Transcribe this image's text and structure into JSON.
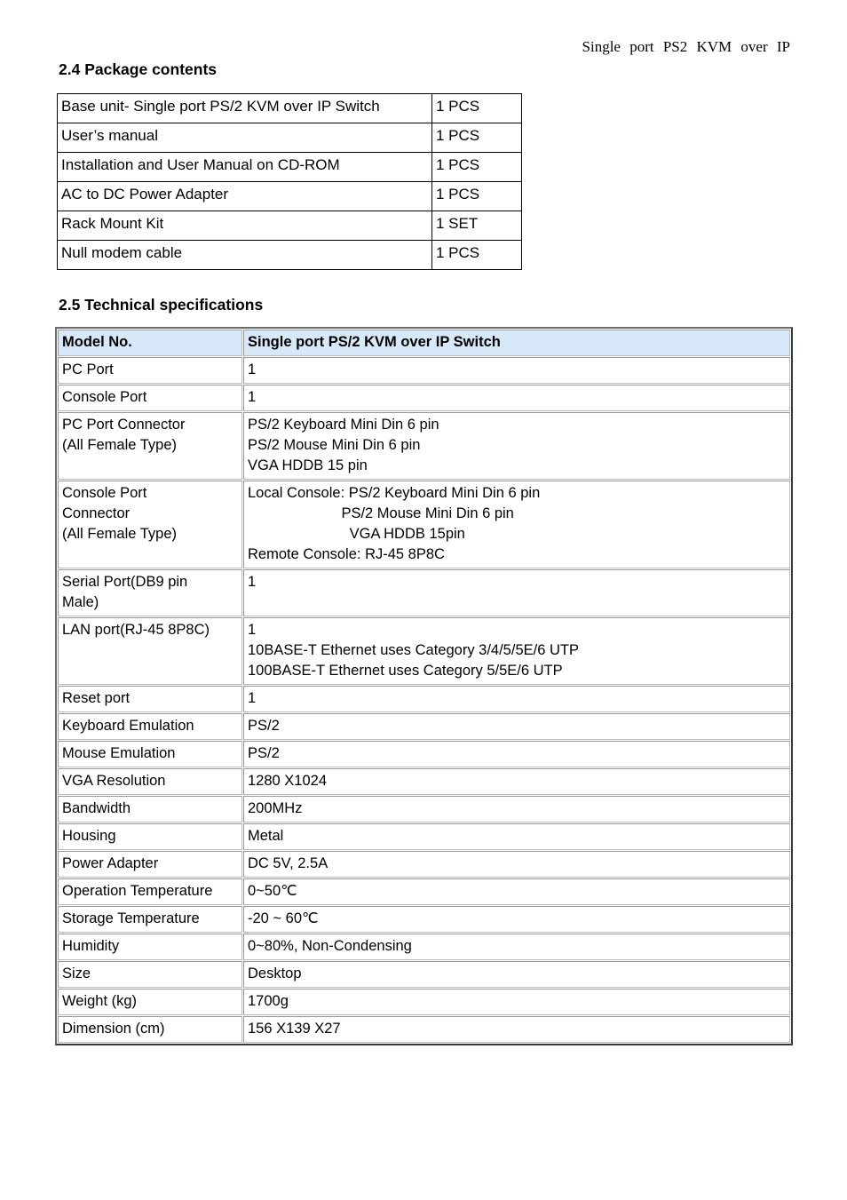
{
  "header": {
    "running_title": "Single port PS2 KVM over IP"
  },
  "sections": {
    "package": {
      "heading": "2.4 Package contents",
      "rows": [
        {
          "item": "Base unit- Single port PS/2 KVM over IP Switch",
          "qty": "1 PCS"
        },
        {
          "item": "User’s manual",
          "qty": "1 PCS"
        },
        {
          "item": "Installation and User Manual on CD-ROM",
          "qty": "1 PCS"
        },
        {
          "item": "AC to DC Power Adapter",
          "qty": "1 PCS"
        },
        {
          "item": "Rack Mount Kit",
          "qty": "1 SET"
        },
        {
          "item": "Null modem cable",
          "qty": "1 PCS"
        }
      ]
    },
    "specs": {
      "heading": "2.5 Technical specifications",
      "header_row": {
        "label": "Model No.",
        "value": "Single port PS/2 KVM over IP Switch"
      },
      "rows": [
        {
          "label": "PC Port",
          "value": "1"
        },
        {
          "label": "Console Port",
          "value": "1"
        },
        {
          "label": "PC Port Connector\n(All Female Type)",
          "value": "PS/2 Keyboard Mini Din 6 pin\nPS/2 Mouse Mini Din 6 pin\nVGA HDDB 15 pin"
        },
        {
          "label": "Console Port\nConnector\n(All Female Type)",
          "value": "Local Console: PS/2 Keyboard Mini Din 6 pin\n                       PS/2 Mouse Mini Din 6 pin\n                         VGA HDDB 15pin\nRemote Console: RJ-45 8P8C"
        },
        {
          "label": "Serial Port(DB9 pin\nMale)",
          "value": "1"
        },
        {
          "label": "LAN port(RJ-45 8P8C)",
          "value": "1\n10BASE-T Ethernet uses Category 3/4/5/5E/6 UTP\n100BASE-T Ethernet uses Category 5/5E/6 UTP"
        },
        {
          "label": "Reset port",
          "value": "1"
        },
        {
          "label": "Keyboard Emulation",
          "value": "PS/2"
        },
        {
          "label": "Mouse Emulation",
          "value": "PS/2"
        },
        {
          "label": "VGA Resolution",
          "value": "1280 X1024"
        },
        {
          "label": "Bandwidth",
          "value": "200MHz"
        },
        {
          "label": "Housing",
          "value": "Metal"
        },
        {
          "label": "Power Adapter",
          "value": "DC 5V, 2.5A"
        },
        {
          "label": "Operation Temperature",
          "value": "0~50℃"
        },
        {
          "label": "Storage Temperature",
          "value": "-20 ~ 60℃"
        },
        {
          "label": "Humidity",
          "value": "0~80%, Non-Condensing"
        },
        {
          "label": "Size",
          "value": "Desktop"
        },
        {
          "label": "Weight (kg)",
          "value": "1700g"
        },
        {
          "label": "Dimension (cm)",
          "value": "156 X139 X27"
        }
      ]
    }
  },
  "colors": {
    "spec_header_background": "#d7e9f8",
    "table_border": "#000000",
    "spec_cell_border": "#999999",
    "text": "#000000"
  }
}
